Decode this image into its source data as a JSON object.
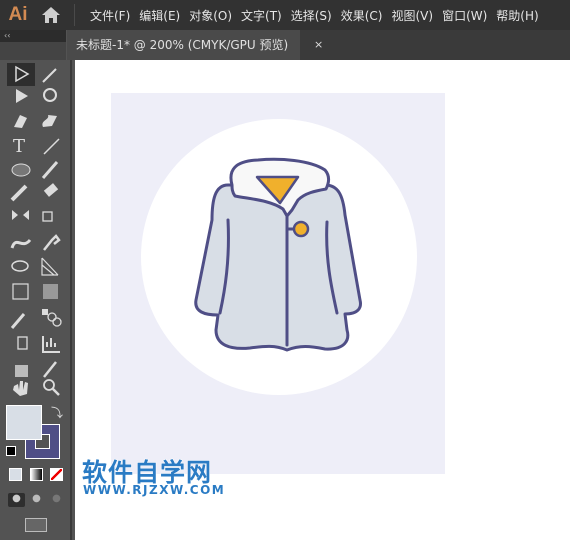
{
  "app": {
    "logo": "Ai",
    "home_icon": "home-icon"
  },
  "menu": [
    "文件(F)",
    "编辑(E)",
    "对象(O)",
    "文字(T)",
    "选择(S)",
    "效果(C)",
    "视图(V)",
    "窗口(W)",
    "帮助(H)"
  ],
  "toolbar_header": "‹‹",
  "tab": {
    "title": "未标题-1* @ 200% (CMYK/GPU 预览)",
    "close": "×"
  },
  "tools": [
    "selection",
    "magic-wand",
    "direct-selection",
    "lasso",
    "pen",
    "curvature",
    "type",
    "line",
    "ellipse",
    "paintbrush",
    "pencil",
    "eraser",
    "reflect",
    "scale",
    "warp",
    "puppet-warp",
    "shape-builder",
    "perspective-grid",
    "mesh",
    "gradient",
    "eyedropper",
    "blend",
    "symbol-sprayer",
    "column-graph",
    "artboard",
    "slice",
    "hand",
    "zoom"
  ],
  "colors": {
    "fill": "#d8dee6",
    "stroke": "#4f4e86",
    "accent": "#f0b02c",
    "artboard_bg": "#eeeef8",
    "ui_dark": "#323232",
    "watermark": "#2a7bc4"
  },
  "watermark": {
    "title": "软件自学网",
    "url": "WWW.RJZXW.COM"
  }
}
